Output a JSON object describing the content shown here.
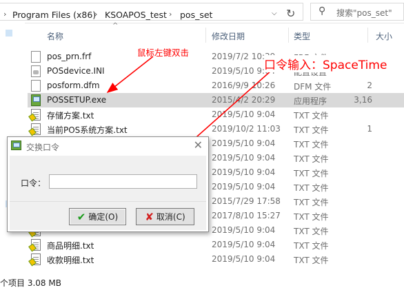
{
  "address": {
    "crumbs": [
      "Program Files (x86)",
      "KSOAPOS_test",
      "pos_set"
    ],
    "dropdown_icon": "chevron-down-icon",
    "refresh_icon": "refresh-icon"
  },
  "search": {
    "placeholder": "搜索\"pos_set\""
  },
  "columns": {
    "name": "名称",
    "date": "修改日期",
    "type": "类型",
    "size": "大小"
  },
  "files": [
    {
      "name": "pos_prn.frf",
      "date": "2019/7/2 10:39",
      "type": "FRF 文件",
      "size": "",
      "icon": "doc-icon"
    },
    {
      "name": "POSdevice.INI",
      "date": "2019/5/10 9:04",
      "type": "配置设置",
      "size": "",
      "icon": "ini-icon"
    },
    {
      "name": "posform.dfm",
      "date": "2016/9/9 10:26",
      "type": "DFM 文件",
      "size": "2",
      "icon": "doc-icon"
    },
    {
      "name": "POSSETUP.exe",
      "date": "2015/4/2 20:29",
      "type": "应用程序",
      "size": "3,16",
      "icon": "exe-icon",
      "selected": true
    },
    {
      "name": "存储方案.txt",
      "date": "2019/5/10 9:04",
      "type": "TXT 文件",
      "size": "",
      "icon": "txt-icon"
    },
    {
      "name": "当前POS系统方案.txt",
      "date": "2019/10/2 11:03",
      "type": "TXT 文件",
      "size": "1",
      "icon": "txt-icon"
    },
    {
      "name": "",
      "date": "2019/5/10 9:04",
      "type": "TXT 文件",
      "size": "",
      "icon": "txt-icon"
    },
    {
      "name": "",
      "date": "2019/5/10 9:04",
      "type": "TXT 文件",
      "size": "",
      "icon": "txt-icon"
    },
    {
      "name": "",
      "date": "2019/5/10 9:04",
      "type": "TXT 文件",
      "size": "",
      "icon": "txt-icon"
    },
    {
      "name": "",
      "date": "2019/5/10 9:04",
      "type": "TXT 文件",
      "size": "",
      "icon": "txt-icon"
    },
    {
      "name": "",
      "date": "2015/7/29 17:58",
      "type": "TXT 文件",
      "size": "",
      "icon": "txt-icon"
    },
    {
      "name": "",
      "date": "2017/8/10 15:27",
      "type": "TXT 文件",
      "size": "",
      "icon": "txt-icon"
    },
    {
      "name": "",
      "date": "2019/5/10 9:04",
      "type": "TXT 文件",
      "size": "",
      "icon": "txt-icon"
    },
    {
      "name": "商品明细.txt",
      "date": "2019/5/10 9:04",
      "type": "TXT 文件",
      "size": "",
      "icon": "txt-icon"
    },
    {
      "name": "收款明细.txt",
      "date": "2019/5/10 9:04",
      "type": "TXT 文件",
      "size": "",
      "icon": "txt-icon"
    }
  ],
  "status": {
    "text": "个项目 3.08 MB"
  },
  "annotations": {
    "dblclick": "鼠标左键双击",
    "password_hint": "口令输入：SpaceTime",
    "color": "#ff0000"
  },
  "dialog": {
    "title": "交换口令",
    "label": "口令：",
    "password_value": "",
    "ok_label": "确定(O)",
    "cancel_label": "取消(C)",
    "close_icon": "close-icon",
    "ok_icon": "check-icon",
    "cancel_icon": "x-icon"
  },
  "colors": {
    "selected_row": "#d9d9d9",
    "header_text": "#4c607a",
    "dialog_body": "#f0f0f0"
  }
}
